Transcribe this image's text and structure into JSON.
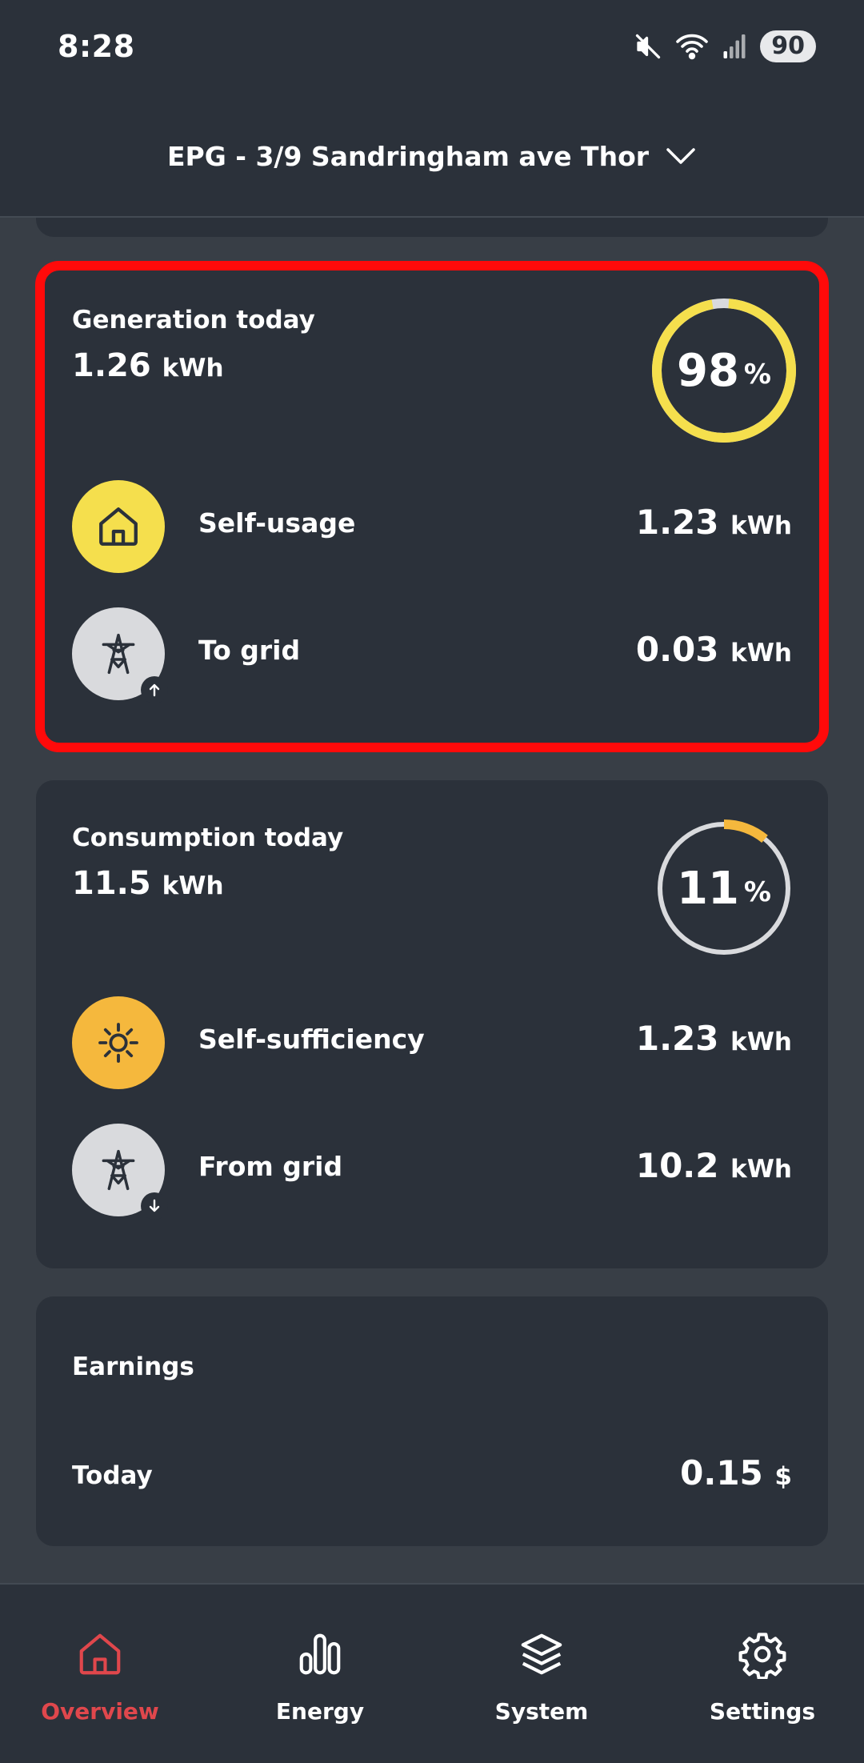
{
  "status_bar": {
    "time": "8:28",
    "battery": "90",
    "icons": [
      "mute-icon",
      "wifi-icon",
      "signal-icon"
    ]
  },
  "header": {
    "site_name": "EPG - 3/9 Sandringham ave Thor",
    "dropdown_icon": "chevron-down-icon"
  },
  "generation": {
    "title": "Generation today",
    "value": "1.26",
    "unit": "kWh",
    "percent": "98",
    "percent_symbol": "%",
    "percent_value": 98,
    "ring_color": "#f5df4d",
    "rows": [
      {
        "label": "Self-usage",
        "value": "1.23",
        "unit": "kWh",
        "icon": "house-icon",
        "icon_bg": "#f5df4d"
      },
      {
        "label": "To grid",
        "value": "0.03",
        "unit": "kWh",
        "icon": "power-tower-icon",
        "badge": "arrow-up-icon",
        "icon_bg": "#d9dadd"
      }
    ]
  },
  "consumption": {
    "title": "Consumption today",
    "value": "11.5",
    "unit": "kWh",
    "percent": "11",
    "percent_symbol": "%",
    "percent_value": 11,
    "ring_color": "#f5b83d",
    "rows": [
      {
        "label": "Self-sufficiency",
        "value": "1.23",
        "unit": "kWh",
        "icon": "sun-icon",
        "icon_bg": "#f5b83d"
      },
      {
        "label": "From grid",
        "value": "10.2",
        "unit": "kWh",
        "icon": "power-tower-icon",
        "badge": "arrow-down-icon",
        "icon_bg": "#d9dadd"
      }
    ]
  },
  "earnings": {
    "title": "Earnings",
    "row_label": "Today",
    "value": "0.15",
    "unit": "$"
  },
  "nav": {
    "items": [
      {
        "label": "Overview",
        "icon": "house-icon",
        "active": true
      },
      {
        "label": "Energy",
        "icon": "bar-chart-icon",
        "active": false
      },
      {
        "label": "System",
        "icon": "layers-icon",
        "active": false
      },
      {
        "label": "Settings",
        "icon": "gear-icon",
        "active": false
      }
    ],
    "active_color": "#e0474c"
  }
}
